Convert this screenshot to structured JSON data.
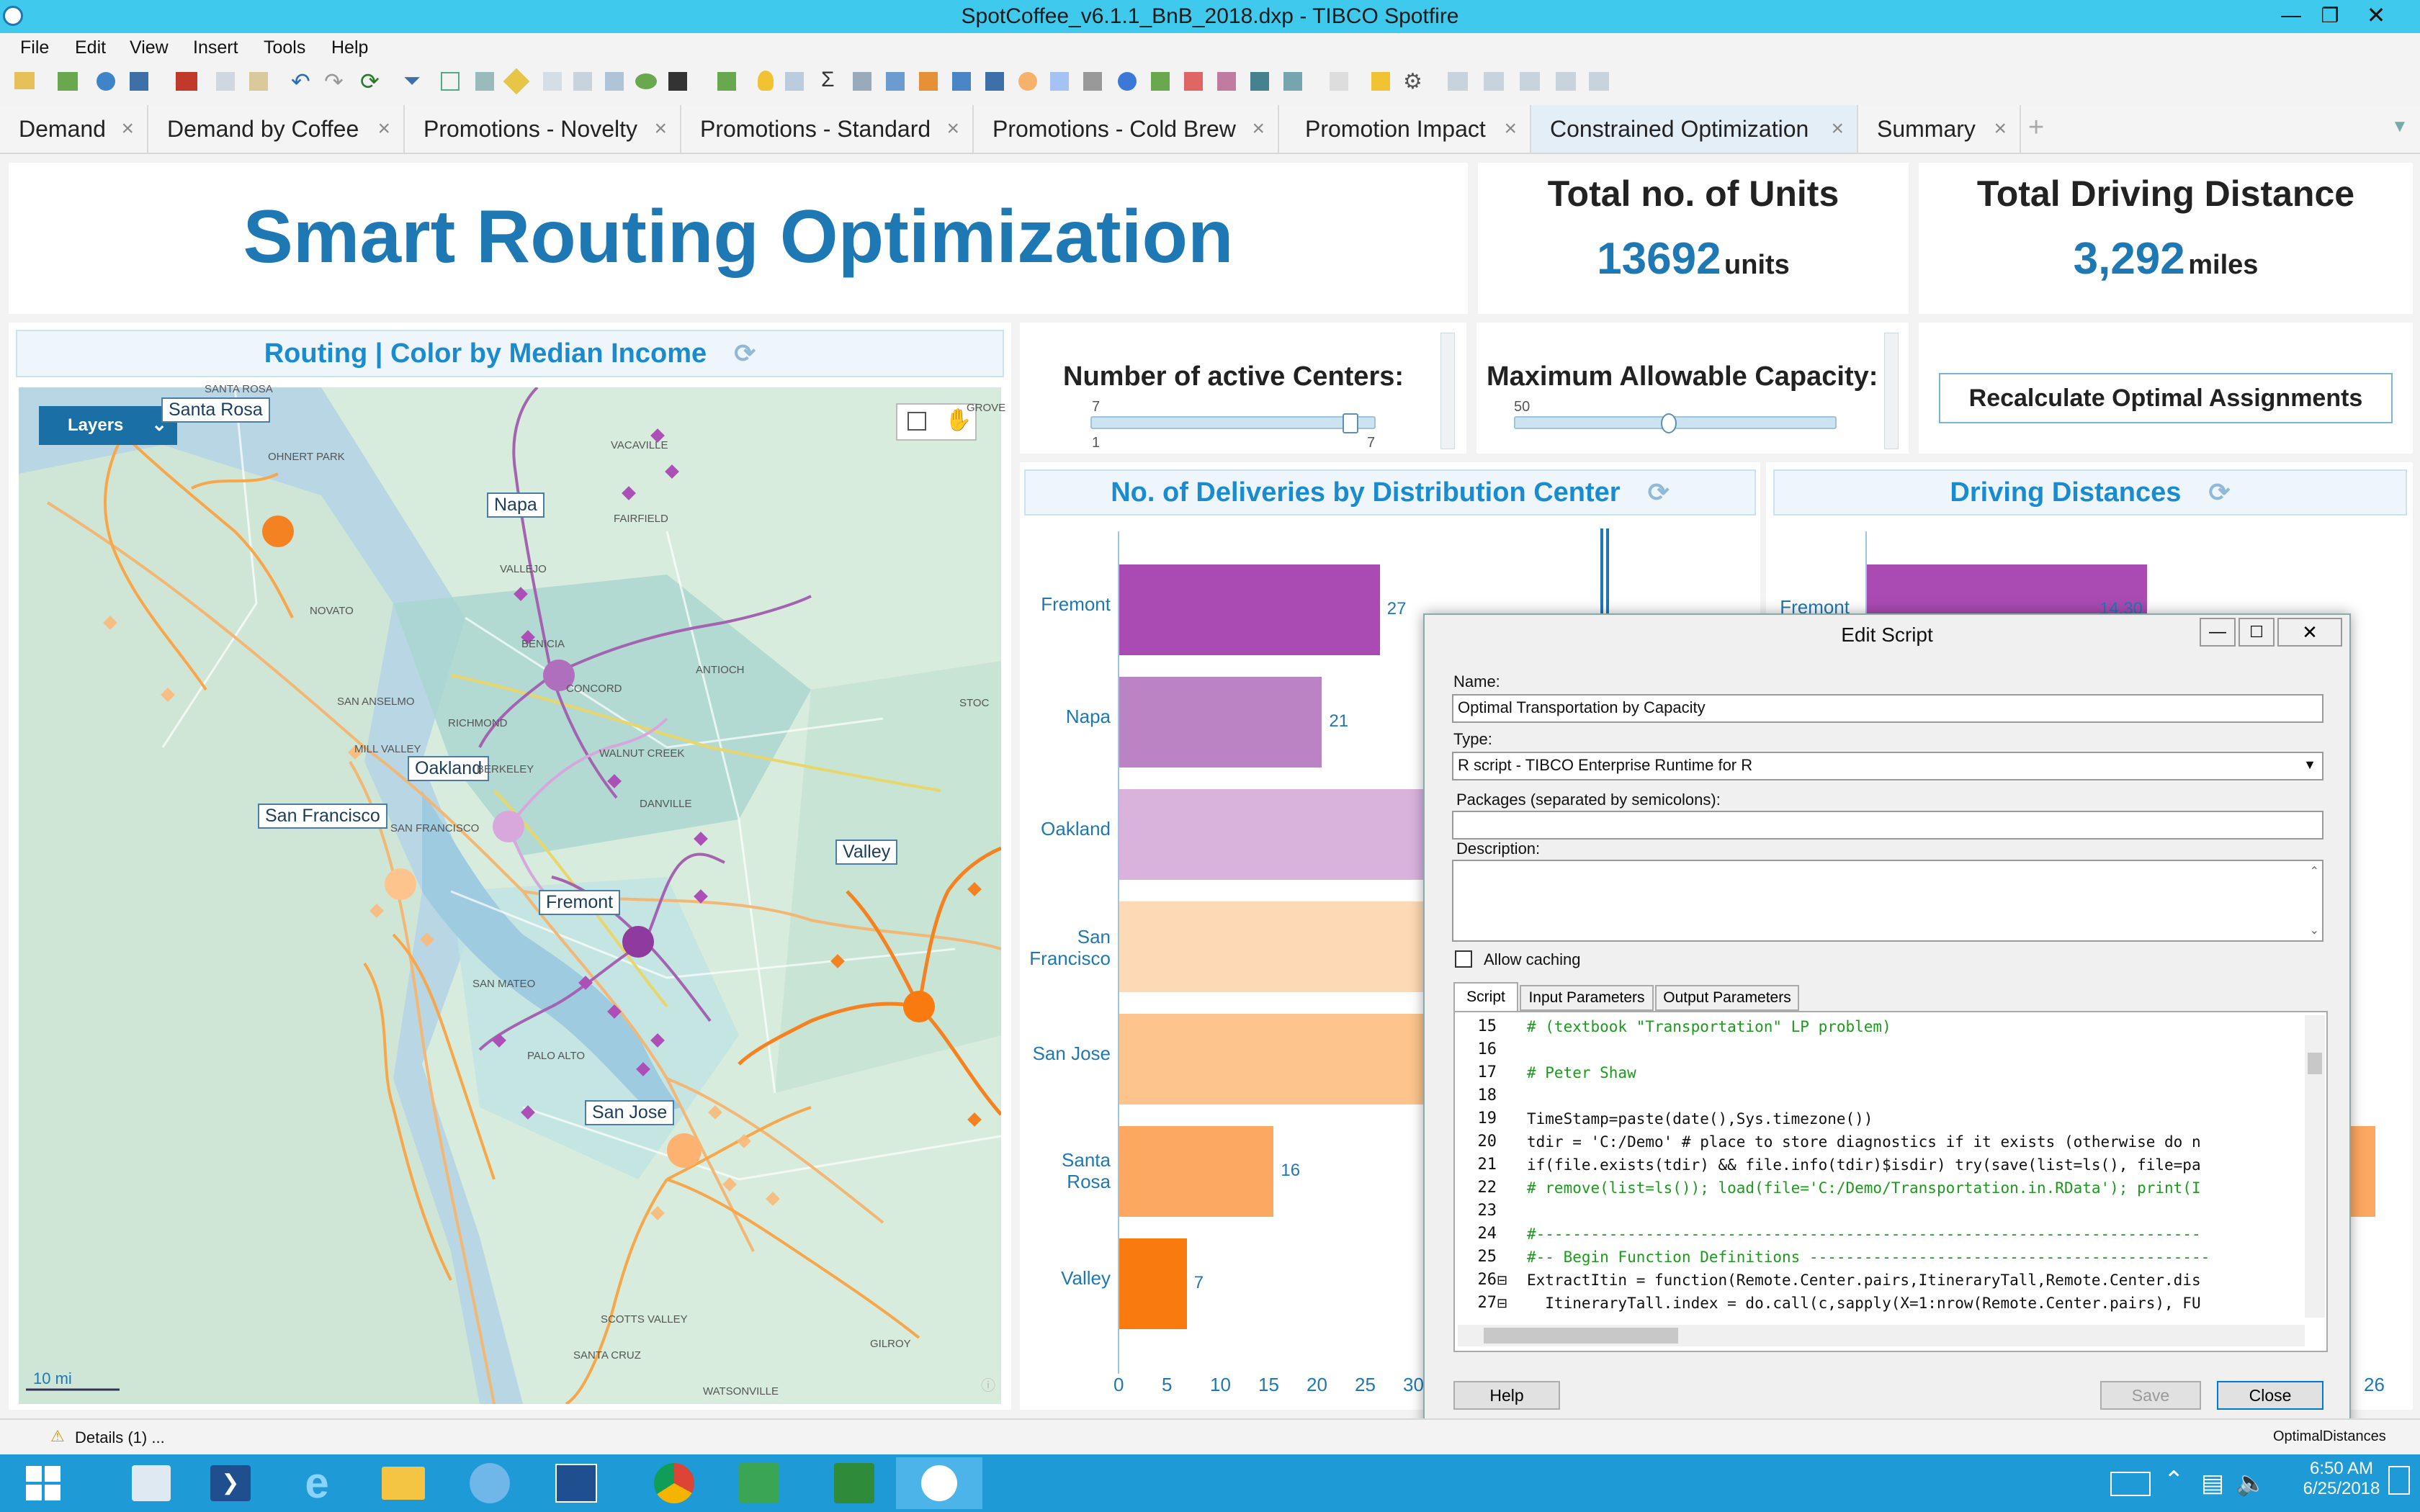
{
  "window": {
    "title": "SpotCoffee_v6.1.1_BnB_2018.dxp - TIBCO Spotfire"
  },
  "menu": [
    "File",
    "Edit",
    "View",
    "Insert",
    "Tools",
    "Help"
  ],
  "tabs": [
    {
      "label": "Demand"
    },
    {
      "label": "Demand by Coffee"
    },
    {
      "label": "Promotions - Novelty"
    },
    {
      "label": "Promotions - Standard"
    },
    {
      "label": "Promotions - Cold Brew"
    },
    {
      "label": "Promotion Impact"
    },
    {
      "label": "Constrained Optimization",
      "active": true
    },
    {
      "label": "Summary"
    }
  ],
  "header": {
    "title": "Smart Routing Optimization"
  },
  "kpi": {
    "units": {
      "title": "Total no. of Units",
      "value": "13692",
      "unit": "units"
    },
    "distance": {
      "title": "Total Driving Distance",
      "value": "3,292",
      "unit": "miles"
    }
  },
  "map": {
    "title": "Routing | Color by Median Income",
    "layers_label": "Layers",
    "scale": "10 mi",
    "places": [
      "Santa Rosa",
      "Napa",
      "Oakland",
      "San Francisco",
      "Valley",
      "Fremont",
      "San Jose"
    ],
    "background_places": [
      "SANTA ROSA",
      "VACAVILLE",
      "FAIRFIELD",
      "VALLEJO",
      "NOVATO",
      "ANTIOCH",
      "CONCORD",
      "SAN ANSELMO",
      "RICHMOND",
      "MILL VALLEY",
      "BERKELEY",
      "WALNUT CREEK",
      "DANVILLE",
      "SAN FRANCISCO",
      "SAN MATEO",
      "SANTA CRUZ",
      "SCOTTS VALLEY",
      "GILROY",
      "STOC",
      "GROVE",
      "OHNERT PARK",
      "BENICIA",
      "PALO ALTO",
      "WATSONVILLE"
    ]
  },
  "controls": {
    "centers": {
      "label": "Number of active Centers:",
      "min": "1",
      "max": "7",
      "value": "7"
    },
    "capacity": {
      "label": "Maximum Allowable Capacity:",
      "value": "50"
    },
    "recalc_button": "Recalculate Optimal Assignments"
  },
  "chart_data": [
    {
      "type": "bar",
      "title": "No. of Deliveries by Distribution Center",
      "orientation": "horizontal",
      "categories": [
        "Fremont",
        "Napa",
        "Oakland",
        "San Francisco",
        "San Jose",
        "Santa Rosa",
        "Valley"
      ],
      "values": [
        27,
        21,
        null,
        null,
        null,
        16,
        7
      ],
      "ticks": [
        "0",
        "5",
        "10",
        "15",
        "20",
        "25",
        "30"
      ],
      "xlim": [
        0,
        35
      ],
      "colors": [
        "#a94bb3",
        "#b983c4",
        "#dab3dd",
        "#fdd9b5",
        "#fdc48d",
        "#fca860",
        "#f97b10"
      ]
    },
    {
      "type": "bar",
      "title": "Driving Distances",
      "orientation": "horizontal",
      "categories": [
        "Fremont"
      ],
      "values": [
        14.3
      ],
      "value_labels": [
        "14.30"
      ],
      "ticks": [
        "26"
      ]
    }
  ],
  "dialog": {
    "title": "Edit Script",
    "name_label": "Name:",
    "name_value": "Optimal Transportation by Capacity",
    "type_label": "Type:",
    "type_value": "R script - TIBCO Enterprise Runtime for R",
    "packages_label": "Packages (separated by semicolons):",
    "description_label": "Description:",
    "caching_label": "Allow caching",
    "tabs": [
      "Script",
      "Input Parameters",
      "Output Parameters"
    ],
    "code_lines": [
      {
        "n": "15",
        "t": "# (textbook \"Transportation\" LP problem)"
      },
      {
        "n": "16",
        "t": ""
      },
      {
        "n": "17",
        "t": "# Peter Shaw"
      },
      {
        "n": "18",
        "t": ""
      },
      {
        "n": "19",
        "t": "TimeStamp=paste(date(),Sys.timezone())"
      },
      {
        "n": "20",
        "t": "tdir = 'C:/Demo' # place to store diagnostics if it exists (otherwise do n"
      },
      {
        "n": "21",
        "t": "if(file.exists(tdir) && file.info(tdir)$isdir) try(save(list=ls(), file=pa"
      },
      {
        "n": "22",
        "t": "# remove(list=ls()); load(file='C:/Demo/Transportation.in.RData'); print(I"
      },
      {
        "n": "23",
        "t": ""
      },
      {
        "n": "24",
        "t": "#-------------------------------------------------------------------------"
      },
      {
        "n": "25",
        "t": "#-- Begin Function Definitions --------------------------------------------"
      },
      {
        "n": "26",
        "t": "ExtractItin = function(Remote.Center.pairs,ItineraryTall,Remote.Center.dis"
      },
      {
        "n": "27",
        "t": "  ItineraryTall.index = do.call(c,sapply(X=1:nrow(Remote.Center.pairs), FU"
      }
    ],
    "help_button": "Help",
    "save_button": "Save",
    "close_button": "Close"
  },
  "status": {
    "details": "Details (1) ...",
    "right_partial": "OptimalDistances"
  },
  "tray": {
    "time": "6:50 AM",
    "date": "6/25/2018"
  }
}
